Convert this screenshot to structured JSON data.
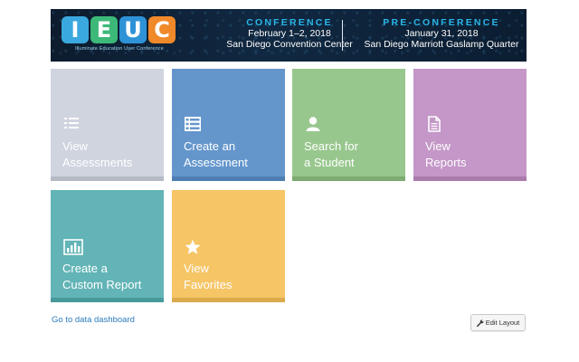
{
  "banner": {
    "logo_letters": [
      "I",
      "E",
      "U",
      "C"
    ],
    "logo_colors": [
      "#3aa8de",
      "#3cb878",
      "#2e92d6",
      "#f0892a"
    ],
    "logo_subtitle": "Illuminate Education User Conference",
    "conference": {
      "title": "CONFERENCE",
      "date": "February 1–2, 2018",
      "venue": "San Diego Convention Center"
    },
    "preconference": {
      "title": "PRE-CONFERENCE",
      "date": "January 31, 2018",
      "venue": "San Diego Marriott Gaslamp Quarter"
    }
  },
  "tiles": [
    {
      "label": "View\nAssessments",
      "icon": "list-icon",
      "color": "#cfd4df",
      "bar_color": "#b5bac5"
    },
    {
      "label": "Create an\nAssessment",
      "icon": "list-create-icon",
      "color": "#6496cc",
      "bar_color": "#4d7db3"
    },
    {
      "label": "Search for\na Student",
      "icon": "user-icon",
      "color": "#98c78e",
      "bar_color": "#7dab72"
    },
    {
      "label": "View\nReports",
      "icon": "document-icon",
      "color": "#c497c8",
      "bar_color": "#a97cad"
    },
    {
      "label": "Create a\nCustom Report",
      "icon": "bar-chart-icon",
      "color": "#62b4b6",
      "bar_color": "#47999b"
    },
    {
      "label": "View\nFavorites",
      "icon": "star-icon",
      "color": "#f6c566",
      "bar_color": "#dbaa4c"
    }
  ],
  "links": {
    "data_dashboard": "Go to data dashboard"
  },
  "buttons": {
    "edit_layout": "Edit Layout"
  }
}
